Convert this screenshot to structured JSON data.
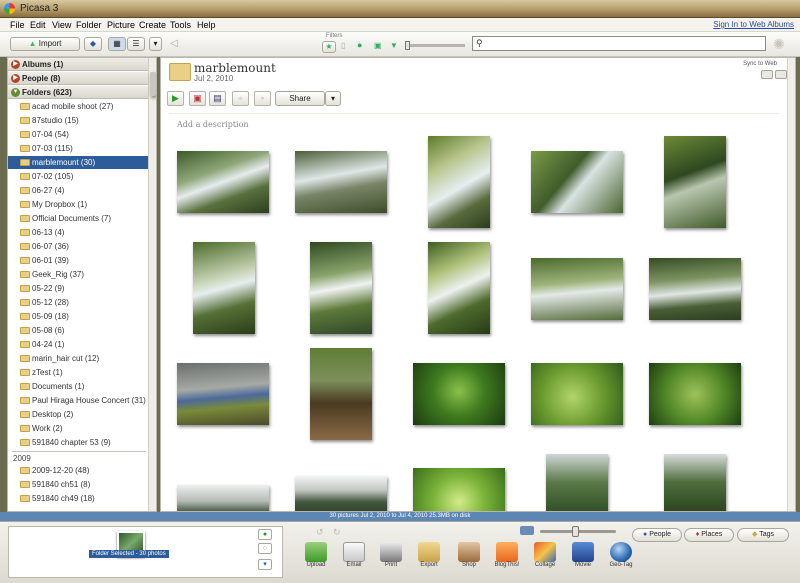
{
  "window": {
    "title": "Picasa 3"
  },
  "menu": [
    "File",
    "Edit",
    "View",
    "Folder",
    "Picture",
    "Create",
    "Tools",
    "Help"
  ],
  "sign_in": "Sign In to Web Albums",
  "toolbar": {
    "import_label": "Import",
    "filters_label": "Filters",
    "search_placeholder": ""
  },
  "sections": {
    "albums": "Albums (1)",
    "people": "People (8)",
    "folders": "Folders (623)"
  },
  "folders": [
    "acad mobile shoot (27)",
    "87studio (15)",
    "07-04 (54)",
    "07-03 (115)",
    "marblemount (30)",
    "07-02 (105)",
    "06-27 (4)",
    "My Dropbox (1)",
    "Official Documents (7)",
    "06-13 (4)",
    "06-07 (36)",
    "06-01 (39)",
    "Geek_Rig (37)",
    "05-22 (9)",
    "05-12 (28)",
    "05-09 (18)",
    "05-08 (6)",
    "04-24 (1)",
    "marin_hair cut (12)",
    "zTest (1)",
    "Documents (1)",
    "Paul Hiraga House Concert (31)",
    "Desktop (2)",
    "Work (2)",
    "591840 chapter 53 (9)"
  ],
  "selected_folder_index": 4,
  "year_label": "2009",
  "folders_2009": [
    "2009-12-20 (48)",
    "591840 ch51 (8)",
    "591840 ch49 (18)"
  ],
  "main": {
    "folder_title": "marblemount",
    "folder_date": "Jul 2, 2010",
    "sync_label": "Sync to Web",
    "share_label": "Share",
    "description_placeholder": "Add a description"
  },
  "status": "30 pictures     Jul 2, 2010 to Jul 4, 2010     25.3MB on disk",
  "tray_label": "Folder Selected - 30 photos",
  "actions": [
    "Upload",
    "Email",
    "Print",
    "Export",
    "Shop",
    "BlogThis!",
    "Collage",
    "Movie",
    "Geo-Tag"
  ],
  "tag_buttons": [
    "People",
    "Places",
    "Tags"
  ]
}
